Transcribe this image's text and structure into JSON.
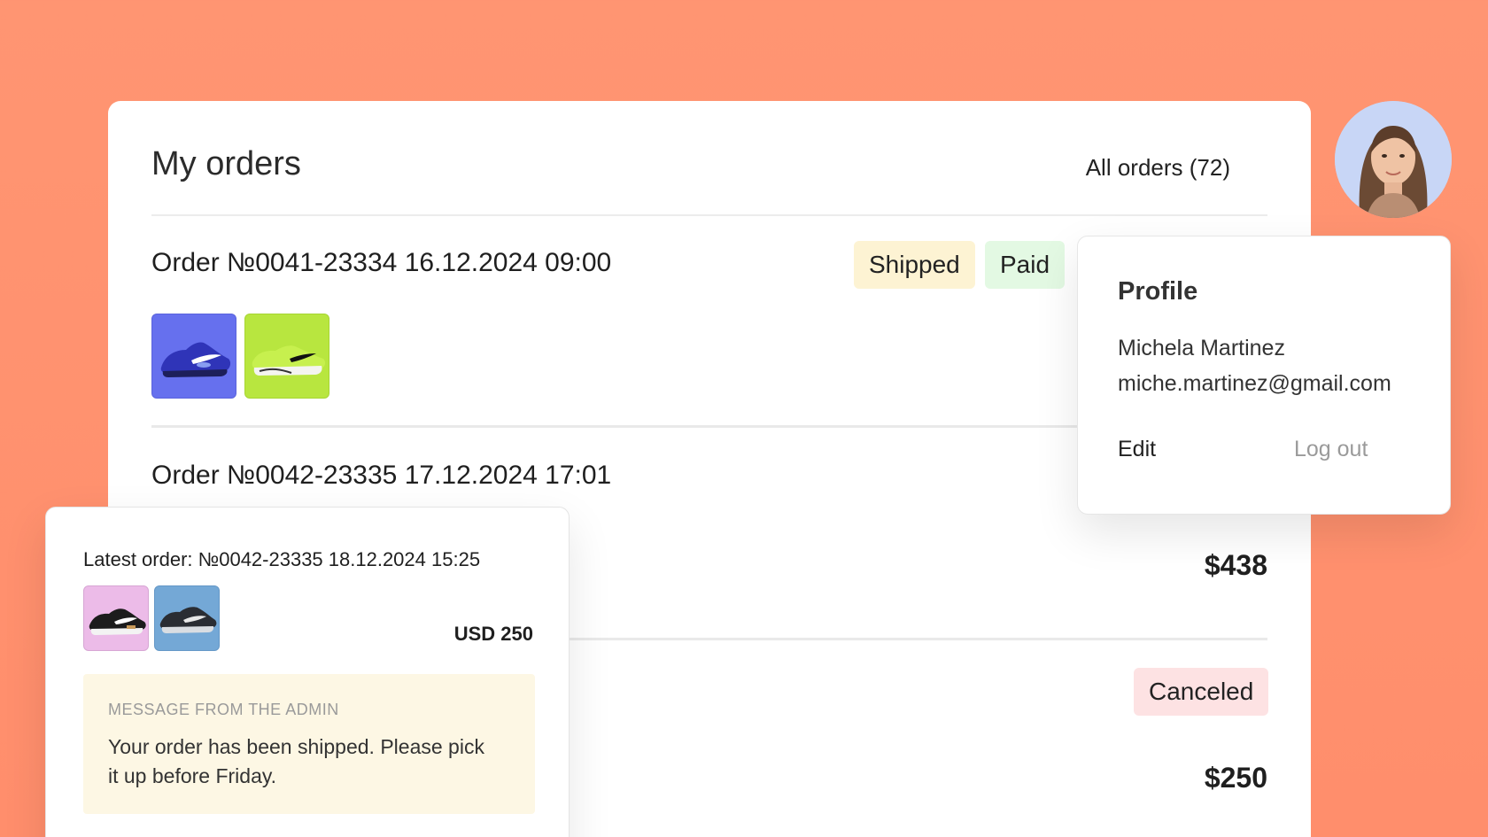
{
  "orders": {
    "title": "My orders",
    "all_orders_link": "All orders (72)",
    "list": [
      {
        "title": "Order №0041-23334 16.12.2024 09:00",
        "badges": [
          "Shipped",
          "Paid"
        ],
        "products": [
          "blue-sneaker",
          "lime-sneaker"
        ]
      },
      {
        "title": "Order №0042-23335 17.12.2024 17:01",
        "total": "$438"
      },
      {
        "badge": "Canceled",
        "total": "$250"
      }
    ]
  },
  "profile": {
    "title": "Profile",
    "name": "Michela Martinez",
    "email": "miche.martinez@gmail.com",
    "edit_label": "Edit",
    "logout_label": "Log out"
  },
  "latest_order": {
    "title": "Latest order: №0042-23335 18.12.2024 15:25",
    "total": "USD 250",
    "products": [
      "black-white-sneaker-pink-bg",
      "dark-sneaker-blue-bg"
    ],
    "admin_message": {
      "label": "MESSAGE FROM THE ADMIN",
      "text": "Your order has been shipped. Please pick it up before Friday."
    }
  },
  "colors": {
    "background": "#ff9572",
    "shipped_badge": "#fdf3d3",
    "paid_badge": "#e3f9e3",
    "canceled_badge": "#fde2e3",
    "admin_message_bg": "#fdf7e4"
  }
}
